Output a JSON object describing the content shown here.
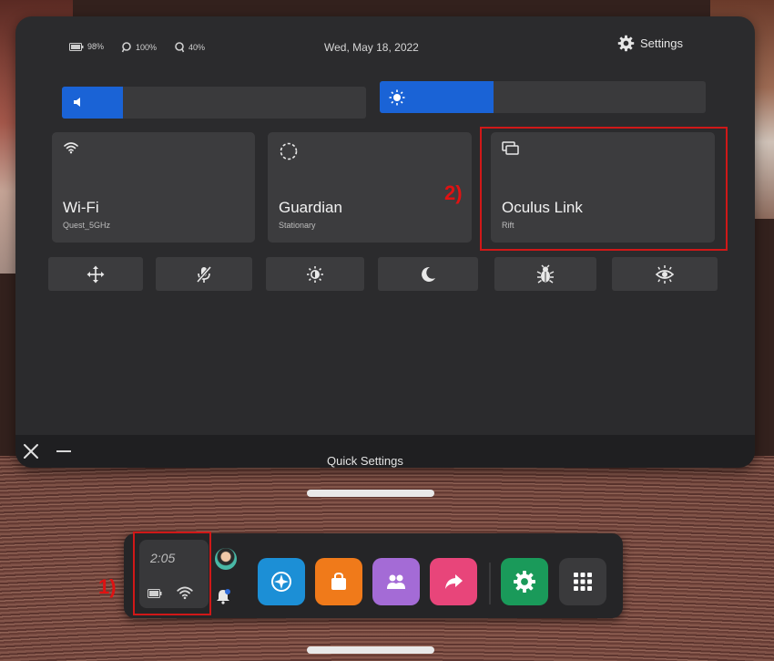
{
  "status_bar": {
    "headset_battery": "98%",
    "left_controller": "100%",
    "right_controller": "40%",
    "date": "Wed, May 18, 2022",
    "settings_label": "Settings"
  },
  "sliders": {
    "volume": 0.2,
    "brightness": 0.35
  },
  "tiles": [
    {
      "title": "Wi-Fi",
      "subtitle": "Quest_5GHz",
      "icon": "wifi-icon"
    },
    {
      "title": "Guardian",
      "subtitle": "Stationary",
      "icon": "guardian-icon"
    },
    {
      "title": "Oculus Link",
      "subtitle": "Rift",
      "icon": "link-icon"
    }
  ],
  "quick_buttons": [
    "move-icon",
    "mic-mute-icon",
    "auto-brightness-icon",
    "night-mode-icon",
    "bug-report-icon",
    "passthrough-icon"
  ],
  "footer": {
    "title": "Quick Settings"
  },
  "dock": {
    "time": "2:05",
    "apps": [
      {
        "name": "explore-app",
        "color": "#1c8fd6"
      },
      {
        "name": "store-app",
        "color": "#f07a1a"
      },
      {
        "name": "people-app",
        "color": "#a46bd6"
      },
      {
        "name": "share-app",
        "color": "#e8457a"
      },
      {
        "name": "settings-app",
        "color": "#1a9a5a"
      },
      {
        "name": "app-library",
        "color": "#3a3a3c"
      }
    ]
  },
  "annotations": {
    "label_1": "1)",
    "label_2": "2)",
    "color": "#d01818"
  }
}
